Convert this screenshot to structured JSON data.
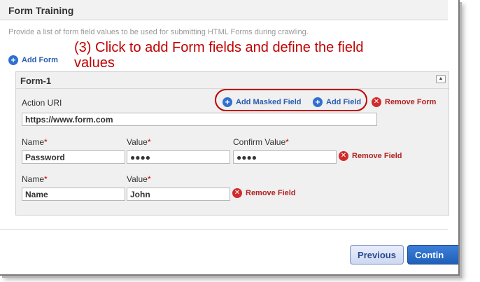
{
  "section": {
    "title": "Form Training",
    "description": "Provide a list of form field values to be used for submitting HTML Forms during crawling."
  },
  "annotation": "(3) Click to add Form fields and define the field values",
  "add_form": {
    "label": "Add Form",
    "icon": "plus-circle-icon"
  },
  "form": {
    "title": "Form-1",
    "action_uri": {
      "label": "Action URI",
      "value": "https://www.form.com"
    },
    "actions": {
      "add_masked_field": "Add Masked Field",
      "add_field": "Add Field",
      "remove_form": "Remove Form"
    },
    "fields": [
      {
        "name_label": "Name",
        "name_value": "Password",
        "value_label": "Value",
        "value_value": "●●●●",
        "confirm_label": "Confirm Value",
        "confirm_value": "●●●●",
        "remove_label": "Remove Field"
      },
      {
        "name_label": "Name",
        "name_value": "Name",
        "value_label": "Value",
        "value_value": "John",
        "remove_label": "Remove Field"
      }
    ],
    "required_marker": "*"
  },
  "footer": {
    "previous": "Previous",
    "continue": "Contin"
  },
  "colors": {
    "link_blue": "#2a5db0",
    "danger_red": "#d12b2b",
    "annotation_red": "#c00000",
    "plus_blue": "#2f6fcf"
  }
}
